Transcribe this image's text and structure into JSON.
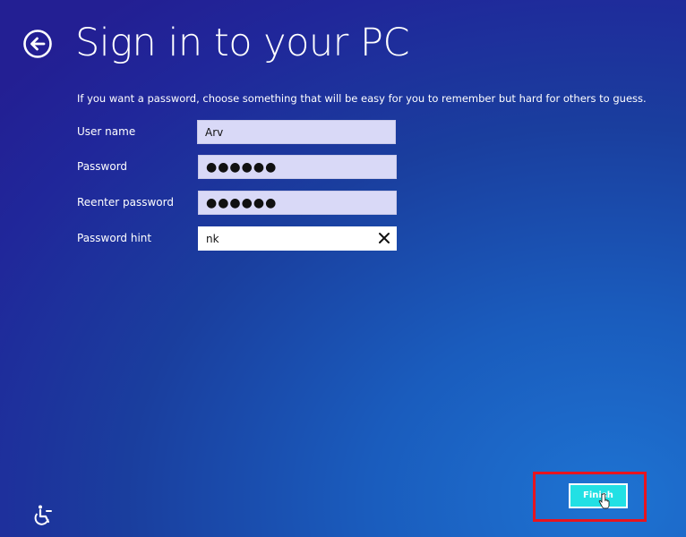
{
  "page": {
    "title": "Sign in to your PC",
    "instruction": "If you want a password, choose something that will be easy for you to remember but hard for others to guess."
  },
  "form": {
    "user_name": {
      "label": "User name",
      "value": "Arv"
    },
    "password": {
      "label": "Password",
      "value": "●●●●●●"
    },
    "reenter_password": {
      "label": "Reenter password",
      "value": "●●●●●●"
    },
    "password_hint": {
      "label": "Password hint",
      "value": "nk"
    }
  },
  "buttons": {
    "finish_label": "Finish"
  },
  "icons": {
    "back": "back-arrow-icon",
    "clear": "close-icon",
    "ease_of_access": "ease-of-access-icon"
  },
  "colors": {
    "background_top": "#231f93",
    "background_bottom": "#1e73d2",
    "finish_button": "#22e0e4",
    "highlight_box": "#e8141e"
  }
}
